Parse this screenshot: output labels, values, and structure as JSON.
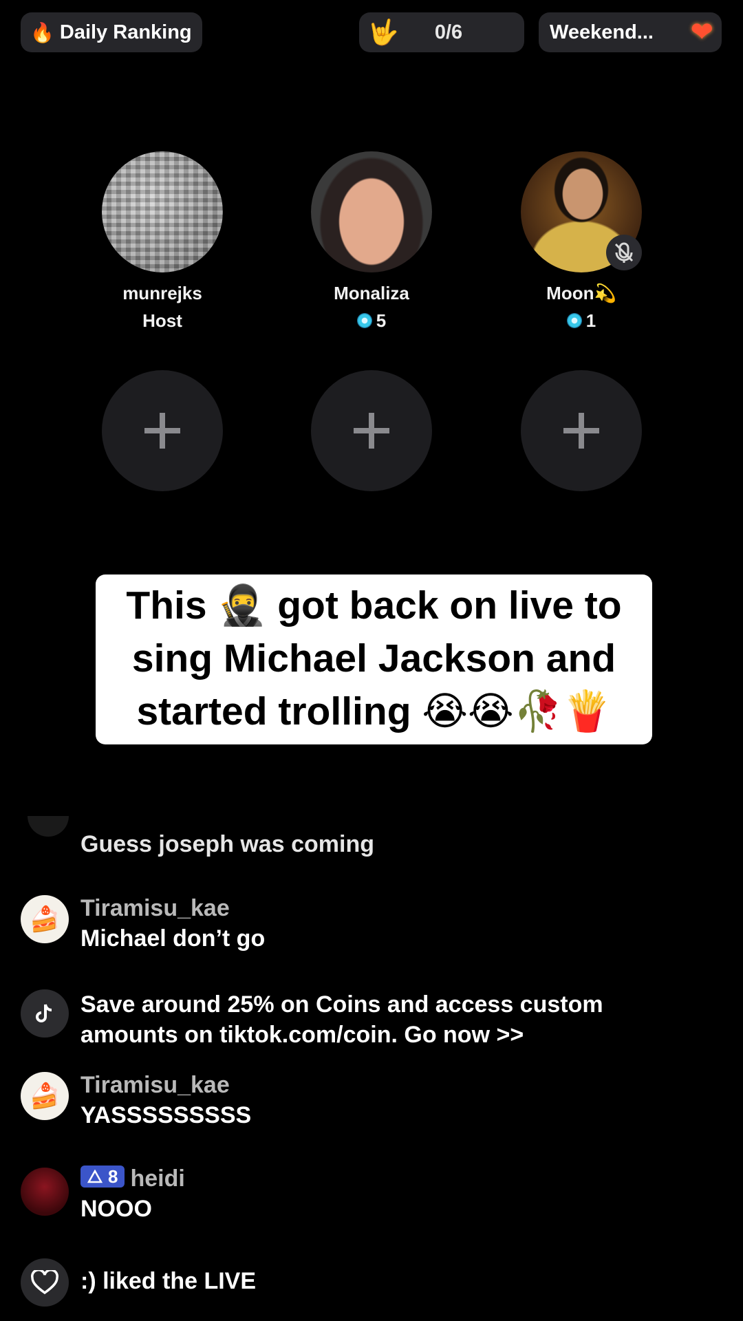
{
  "top_bar": {
    "daily_ranking_label": "Daily Ranking",
    "flame_icon": "🔥",
    "hand_icon": "🤟",
    "counter": "0/6",
    "weekend_label": "Weekend...",
    "heart_icon": "❤"
  },
  "seats": [
    {
      "name": "munrejks",
      "sub": "Host",
      "gems": null
    },
    {
      "name": "Monaliza",
      "sub": null,
      "gems": "5"
    },
    {
      "name": "Moon💫",
      "sub": null,
      "gems": "1",
      "muted": true
    }
  ],
  "empty_seats": [
    "+",
    "+",
    "+"
  ],
  "caption": {
    "line1": "This 🥷 got back on live to",
    "line2": "sing Michael Jackson and",
    "line3": "started trolling 😭😭🥀🍟"
  },
  "comments": [
    {
      "user": "",
      "message": "Guess joseph was coming"
    },
    {
      "user": "Tiramisu_kae",
      "message": "Michael don’t go",
      "avatar": "🍰"
    },
    {
      "user": "",
      "message_line1": "Save around 25% on Coins and access custom",
      "message_line2": "amounts on tiktok.com/coin. Go now >>",
      "avatar": "tiktok-icon"
    },
    {
      "user": "Tiramisu_kae",
      "message": "YASSSSSSSSS",
      "avatar": "🍰"
    },
    {
      "user": "heidi",
      "level": "8",
      "message": "NOOO"
    },
    {
      "user": ":)",
      "message": ":) liked the LIVE",
      "avatar": "heart-outline-icon"
    }
  ],
  "colors": {
    "background": "#000000",
    "pill": "#26262a",
    "empty_seat": "#1d1d20",
    "level_badge": "#3b55c9",
    "username": "#b9b9b9"
  }
}
